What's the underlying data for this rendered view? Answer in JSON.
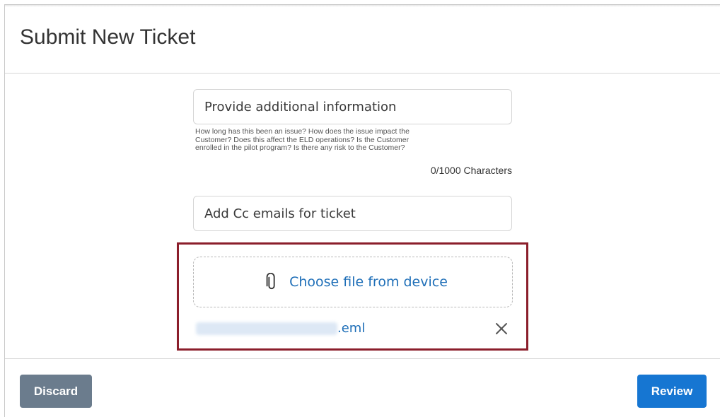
{
  "header": {
    "title": "Submit New Ticket"
  },
  "additional_info": {
    "placeholder": "Provide additional information",
    "help_lines": [
      "How long has this been an issue? How does the issue impact the",
      "Customer? Does this affect the ELD operations? Is the Customer",
      "enrolled in the pilot program? Is there any risk to the Customer?"
    ],
    "counter": "0/1000 Characters"
  },
  "cc": {
    "placeholder": "Add Cc emails for ticket"
  },
  "upload": {
    "choose_label": "Choose file from device",
    "attached_file_ext": ".eml"
  },
  "footer": {
    "discard_label": "Discard",
    "review_label": "Review"
  },
  "colors": {
    "link": "#1f6fb8",
    "highlight": "#8b1e2b",
    "review": "#1676d2",
    "discard": "#6b7c8d"
  },
  "icons": {
    "attach": "paperclip-icon",
    "remove": "close-icon"
  }
}
